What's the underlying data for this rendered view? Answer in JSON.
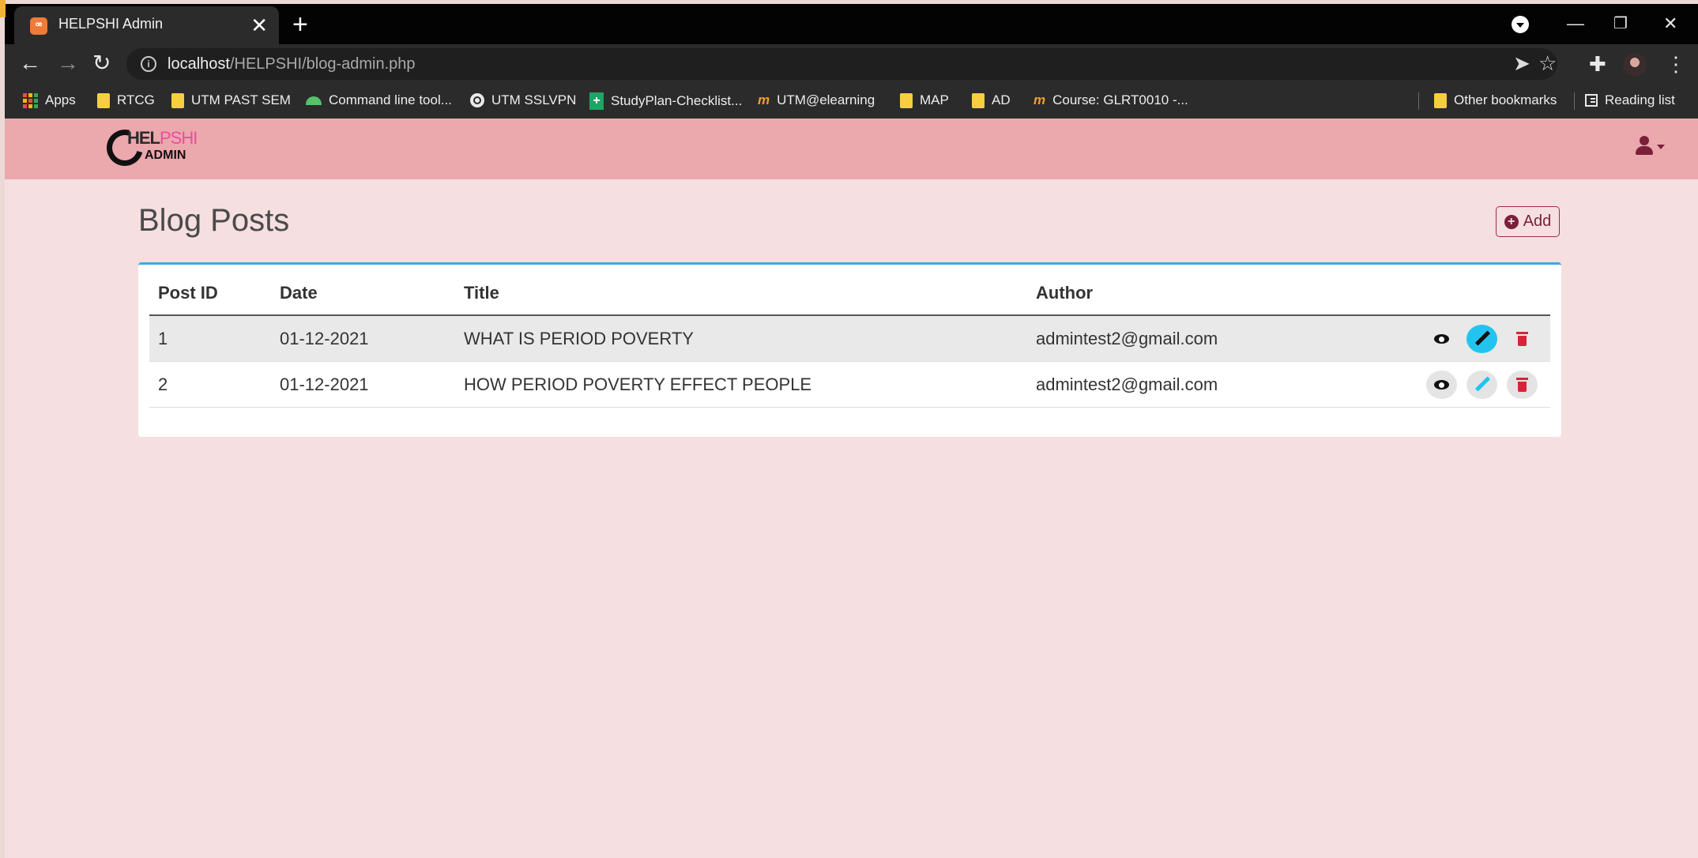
{
  "browser": {
    "tab": {
      "favicon": "xampp-icon",
      "title": "HELPSHI Admin"
    },
    "url": {
      "host": "localhost",
      "path": "/HELPSHI/blog-admin.php"
    },
    "bookmarks": [
      {
        "label": "Apps",
        "icon": "apps-grid-icon"
      },
      {
        "label": "RTCG",
        "icon": "folder-icon"
      },
      {
        "label": "UTM PAST SEM",
        "icon": "folder-icon"
      },
      {
        "label": "Command line tool...",
        "icon": "android-icon"
      },
      {
        "label": "UTM SSLVPN",
        "icon": "globe-icon"
      },
      {
        "label": "StudyPlan-Checklist...",
        "icon": "sheets-icon"
      },
      {
        "label": "UTM@elearning",
        "icon": "moodle-icon"
      },
      {
        "label": "MAP",
        "icon": "folder-icon"
      },
      {
        "label": "AD",
        "icon": "folder-icon"
      },
      {
        "label": "Course: GLRT0010 -...",
        "icon": "moodle-icon"
      }
    ],
    "bookmarks_right": [
      {
        "label": "Other bookmarks",
        "icon": "folder-icon"
      },
      {
        "label": "Reading list",
        "icon": "reading-list-icon"
      }
    ]
  },
  "app": {
    "logo": {
      "top_dark": "HEL",
      "top_pink": "PSHI",
      "bottom": "ADMIN"
    },
    "page_title": "Blog Posts",
    "add_label": "Add",
    "columns": [
      "Post ID",
      "Date",
      "Title",
      "Author"
    ],
    "rows": [
      {
        "id": "1",
        "date": "01-12-2021",
        "title": "WHAT IS PERIOD POVERTY",
        "author": "admintest2@gmail.com"
      },
      {
        "id": "2",
        "date": "01-12-2021",
        "title": "HOW PERIOD POVERTY EFFECT PEOPLE",
        "author": "admintest2@gmail.com"
      }
    ]
  },
  "colors": {
    "navbar": "#eba8ad",
    "page_bg": "#f5dfe0",
    "accent": "#7a1f3a",
    "card_top_border": "#3da9e6",
    "edit_active": "#22c4ef",
    "delete": "#d6253a"
  }
}
